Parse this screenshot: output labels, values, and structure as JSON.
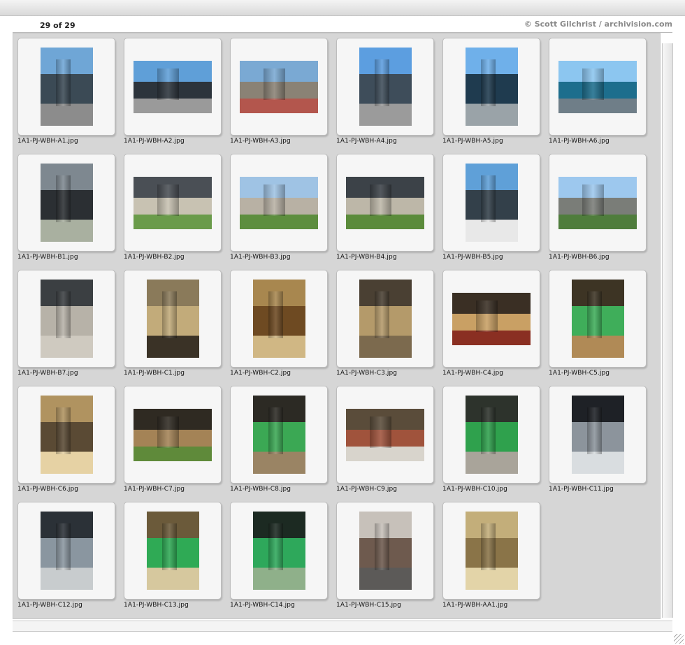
{
  "header": {
    "count": "29 of 29",
    "credit": "© Scott Gilchrist / archivision.com"
  },
  "thumbnails": [
    {
      "filename": "1A1-PJ-WBH-A1.jpg",
      "orientation": "portrait",
      "colors": [
        "#6fa6d6",
        "#3b4a55",
        "#8c8c8c"
      ]
    },
    {
      "filename": "1A1-PJ-WBH-A2.jpg",
      "orientation": "landscape",
      "colors": [
        "#5f9fd8",
        "#2c343c",
        "#9a9a9a"
      ]
    },
    {
      "filename": "1A1-PJ-WBH-A3.jpg",
      "orientation": "landscape",
      "colors": [
        "#7aa9d3",
        "#8a8275",
        "#b3564d"
      ]
    },
    {
      "filename": "1A1-PJ-WBH-A4.jpg",
      "orientation": "portrait",
      "colors": [
        "#5c9ee0",
        "#3e4d5a",
        "#9b9b9b"
      ]
    },
    {
      "filename": "1A1-PJ-WBH-A5.jpg",
      "orientation": "portrait",
      "colors": [
        "#6fb0ea",
        "#1f3b4f",
        "#9aa3a8"
      ]
    },
    {
      "filename": "1A1-PJ-WBH-A6.jpg",
      "orientation": "landscape",
      "colors": [
        "#8cc6f0",
        "#1d6e8d",
        "#6f7e88"
      ]
    },
    {
      "filename": "1A1-PJ-WBH-B1.jpg",
      "orientation": "portrait",
      "colors": [
        "#7e8890",
        "#2b2f33",
        "#a9b0a0"
      ]
    },
    {
      "filename": "1A1-PJ-WBH-B2.jpg",
      "orientation": "landscape",
      "colors": [
        "#4a4f55",
        "#c8c2b2",
        "#6a9b4a"
      ]
    },
    {
      "filename": "1A1-PJ-WBH-B3.jpg",
      "orientation": "landscape",
      "colors": [
        "#9fc3e4",
        "#b8b1a4",
        "#5d8e3e"
      ]
    },
    {
      "filename": "1A1-PJ-WBH-B4.jpg",
      "orientation": "landscape",
      "colors": [
        "#3c4248",
        "#bdb7a8",
        "#5b8b3b"
      ]
    },
    {
      "filename": "1A1-PJ-WBH-B5.jpg",
      "orientation": "portrait",
      "colors": [
        "#5fa0d8",
        "#33404a",
        "#e8e8e8"
      ]
    },
    {
      "filename": "1A1-PJ-WBH-B6.jpg",
      "orientation": "landscape",
      "colors": [
        "#9dc8ee",
        "#7a7d78",
        "#4f7d3c"
      ]
    },
    {
      "filename": "1A1-PJ-WBH-B7.jpg",
      "orientation": "portrait",
      "colors": [
        "#3b3f42",
        "#b7b2a8",
        "#cfcac0"
      ]
    },
    {
      "filename": "1A1-PJ-WBH-C1.jpg",
      "orientation": "portrait",
      "colors": [
        "#8a7a5a",
        "#c2ab7a",
        "#3a3226"
      ]
    },
    {
      "filename": "1A1-PJ-WBH-C2.jpg",
      "orientation": "portrait",
      "colors": [
        "#a8874f",
        "#6e4a22",
        "#d0b784"
      ]
    },
    {
      "filename": "1A1-PJ-WBH-C3.jpg",
      "orientation": "portrait",
      "colors": [
        "#4a4033",
        "#b49a6a",
        "#7c6a4e"
      ]
    },
    {
      "filename": "1A1-PJ-WBH-C4.jpg",
      "orientation": "landscape",
      "colors": [
        "#3a2f24",
        "#c9a064",
        "#8a2f22"
      ]
    },
    {
      "filename": "1A1-PJ-WBH-C5.jpg",
      "orientation": "portrait",
      "colors": [
        "#3d3424",
        "#3fae5a",
        "#b08a56"
      ]
    },
    {
      "filename": "1A1-PJ-WBH-C6.jpg",
      "orientation": "portrait",
      "colors": [
        "#b09360",
        "#5a4a34",
        "#e6d2a4"
      ]
    },
    {
      "filename": "1A1-PJ-WBH-C7.jpg",
      "orientation": "landscape",
      "colors": [
        "#2f2a22",
        "#a48356",
        "#5f8a3a"
      ]
    },
    {
      "filename": "1A1-PJ-WBH-C8.jpg",
      "orientation": "portrait",
      "colors": [
        "#2c2a24",
        "#3ba854",
        "#9a8464"
      ]
    },
    {
      "filename": "1A1-PJ-WBH-C9.jpg",
      "orientation": "landscape",
      "colors": [
        "#5a4c3a",
        "#a0533c",
        "#d8d4cc"
      ]
    },
    {
      "filename": "1A1-PJ-WBH-C10.jpg",
      "orientation": "portrait",
      "colors": [
        "#2d332c",
        "#2fa14d",
        "#a9a49a"
      ]
    },
    {
      "filename": "1A1-PJ-WBH-C11.jpg",
      "orientation": "portrait",
      "colors": [
        "#1e2126",
        "#8c949c",
        "#d9dde0"
      ]
    },
    {
      "filename": "1A1-PJ-WBH-C12.jpg",
      "orientation": "portrait",
      "colors": [
        "#2b3137",
        "#8a96a0",
        "#c8ccce"
      ]
    },
    {
      "filename": "1A1-PJ-WBH-C13.jpg",
      "orientation": "portrait",
      "colors": [
        "#6b5a3a",
        "#2faa55",
        "#d6c89e"
      ]
    },
    {
      "filename": "1A1-PJ-WBH-C14.jpg",
      "orientation": "portrait",
      "colors": [
        "#1c2a22",
        "#2ea85b",
        "#8fb08a"
      ]
    },
    {
      "filename": "1A1-PJ-WBH-C15.jpg",
      "orientation": "portrait",
      "colors": [
        "#c7c1ba",
        "#6e5a4e",
        "#5c5a58"
      ]
    },
    {
      "filename": "1A1-PJ-WBH-AA1.jpg",
      "orientation": "portrait",
      "colors": [
        "#c3ae7a",
        "#8a7448",
        "#e3d4a8"
      ]
    }
  ]
}
